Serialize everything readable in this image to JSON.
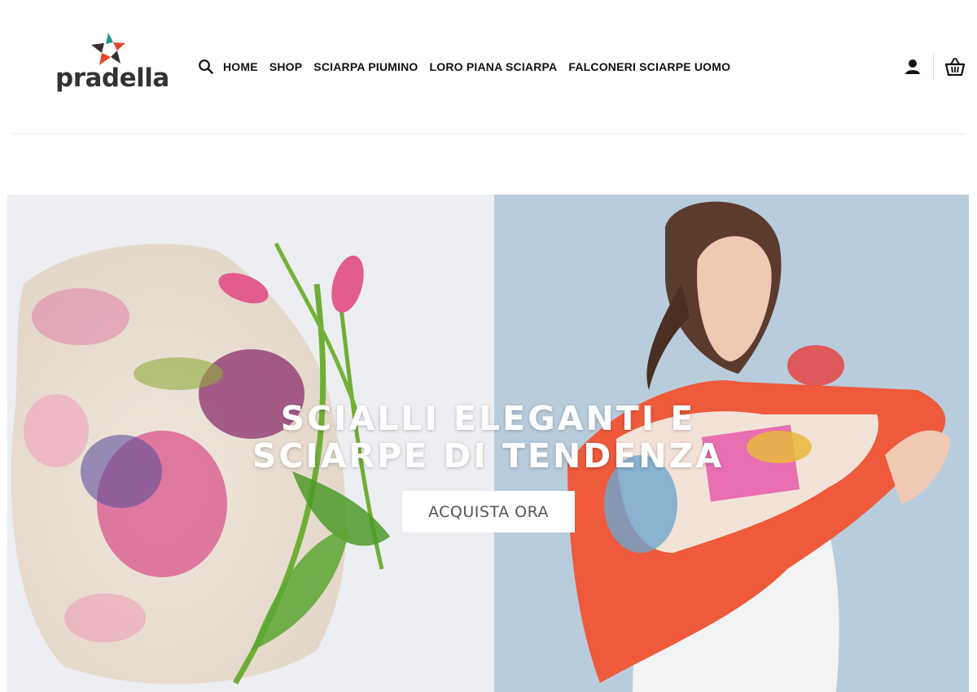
{
  "brand": {
    "name": "pradella",
    "colors": {
      "red": "#e8452c",
      "teal": "#1a9c8c",
      "dark": "#333333"
    }
  },
  "header": {
    "nav": [
      {
        "label": "HOME"
      },
      {
        "label": "SHOP"
      },
      {
        "label": "SCIARPA PIUMINO"
      },
      {
        "label": "LORO PIANA SCIARPA"
      },
      {
        "label": "FALCONERI SCIARPE UOMO"
      }
    ],
    "icons": {
      "search": "search-icon",
      "account": "user-icon",
      "cart": "basket-icon"
    }
  },
  "hero": {
    "title_line1": "SCIALLI ELEGANTI E",
    "title_line2": "SCIARPE DI TENDENZA",
    "cta_label": "ACQUISTA ORA",
    "colors": {
      "left_bg": "#eceef2",
      "right_bg": "#b9ccdc",
      "title": "#ffffff"
    }
  }
}
